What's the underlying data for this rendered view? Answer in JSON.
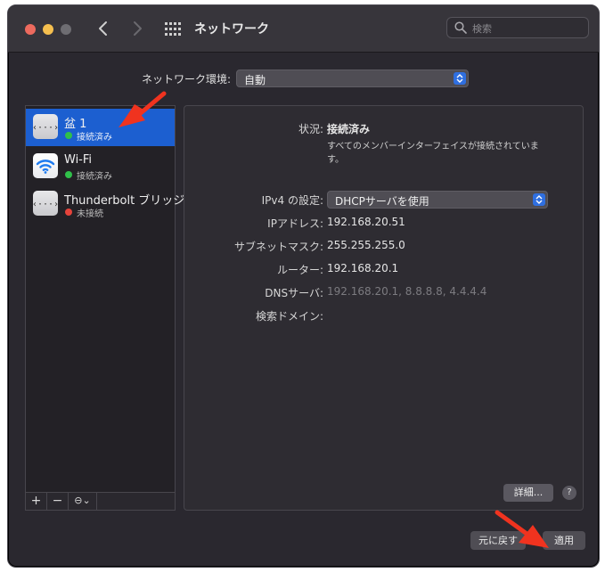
{
  "window": {
    "title": "ネットワーク",
    "search_placeholder": "検索"
  },
  "location": {
    "label": "ネットワーク環境:",
    "value": "自動"
  },
  "services": [
    {
      "name": "盆 1",
      "status": "接続済み",
      "status_color": "#30c04a",
      "icon": "ethernet-icon",
      "selected": true
    },
    {
      "name": "Wi-Fi",
      "status": "接続済み",
      "status_color": "#30c04a",
      "icon": "wifi-icon",
      "selected": false
    },
    {
      "name": "Thunderbolt ブリッジ",
      "status": "未接続",
      "status_color": "#e5433b",
      "icon": "ethernet-icon",
      "selected": false
    }
  ],
  "sidebar_buttons": {
    "add": "+",
    "remove": "−",
    "action": "⊖⌄"
  },
  "details": {
    "status_label": "状況:",
    "status_value": "接続済み",
    "status_description": "すべてのメンバーインターフェイスが接続されています。",
    "ipv4_label": "IPv4 の設定:",
    "ipv4_value": "DHCPサーバを使用",
    "ip_label": "IPアドレス:",
    "ip_value": "192.168.20.51",
    "subnet_label": "サブネットマスク:",
    "subnet_value": "255.255.255.0",
    "router_label": "ルーター:",
    "router_value": "192.168.20.1",
    "dns_label": "DNSサーバ:",
    "dns_value": "192.168.20.1, 8.8.8.8, 4.4.4.4",
    "search_domain_label": "検索ドメイン:",
    "advanced_button": "詳細...",
    "help_button": "?"
  },
  "footer": {
    "revert_button": "元に戻す",
    "apply_button": "適用"
  },
  "colors": {
    "accent": "#1c5fd0",
    "annotation": "#f0331f"
  }
}
